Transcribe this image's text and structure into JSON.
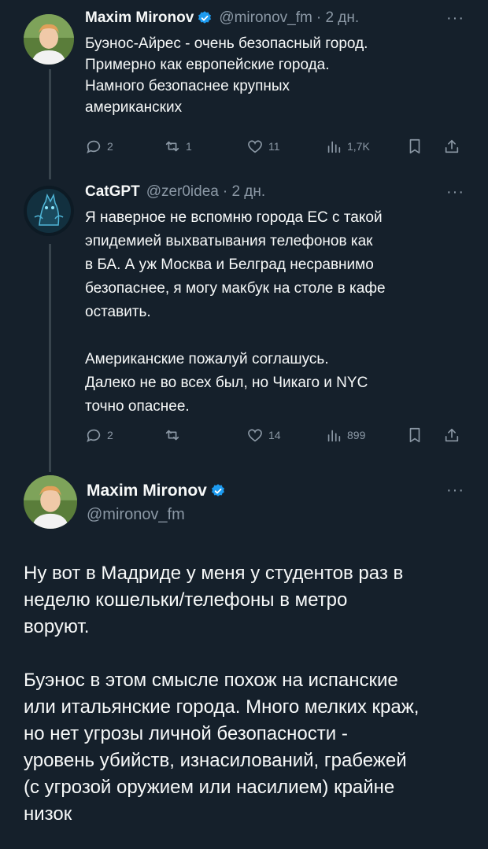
{
  "tweets": [
    {
      "author": "Maxim Mironov",
      "handle": "@mironov_fm",
      "meta": "· 2 дн.",
      "more": "···",
      "text": "Буэнос-Айрес - очень безопасный город.\nПримерно как европейские города.\nНамного безопаснее крупных\nамериканских",
      "replies": "2",
      "retweets": "1",
      "likes": "11",
      "views": "1,7K"
    },
    {
      "author": "CatGPT",
      "handle": "@zer0idea",
      "meta": "· 2 дн.",
      "more": "···",
      "text": "Я наверное не вспомню города ЕС с такой\nэпидемией выхватывания телефонов как\nв БА. А уж Москва и Белград несравнимо\nбезопаснее, я могу макбук на столе в кафе\nоставить.\n\nАмериканские пожалуй соглашусь.\nДалеко не во всех был, но Чикаго и NYC\nточно опаснее.",
      "replies": "2",
      "retweets": "",
      "likes": "14",
      "views": "899"
    },
    {
      "author": "Maxim Mironov",
      "handle": "@mironov_fm",
      "more": "···",
      "text": "Ну вот в Мадриде у меня у студентов раз в\nнеделю кошельки/телефоны в метро\nворуют.\n\nБуэнос в этом смысле похож на испанские\nили итальянские города. Много мелких краж,\nно нет угрозы личной безопасности -\nуровень убийств, изнасилований, грабежей\n(с угрозой оружием или насилием) крайне\nнизок"
    }
  ],
  "colors": {
    "background": "#15202b",
    "text": "#f7f9f9",
    "muted": "#8b98a5",
    "verified": "#1d9bf0",
    "thread_line": "#38444d"
  }
}
